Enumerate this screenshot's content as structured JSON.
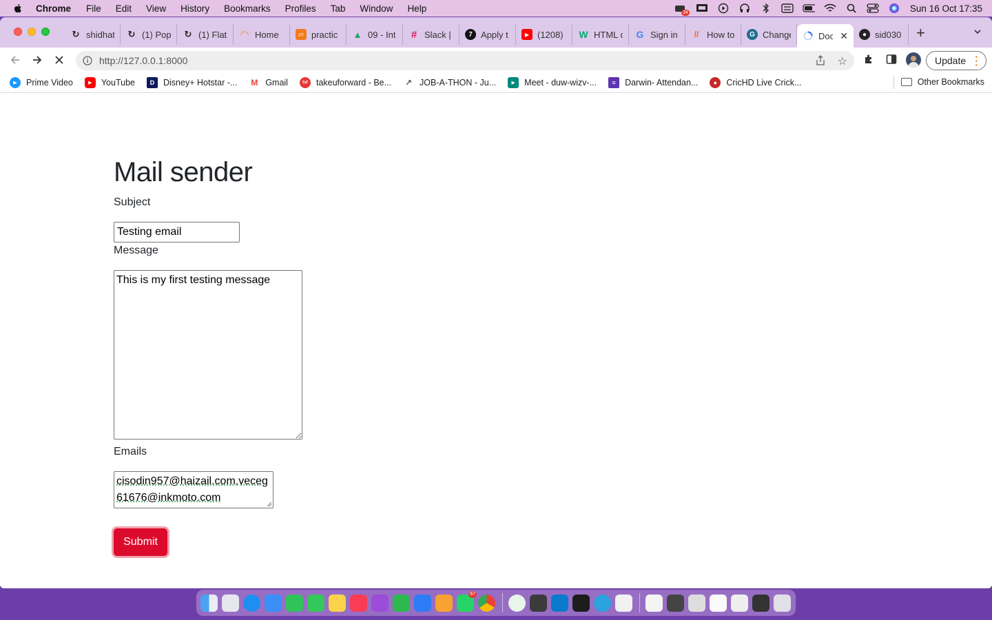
{
  "menubar": {
    "app_name": "Chrome",
    "items": [
      "File",
      "Edit",
      "View",
      "History",
      "Bookmarks",
      "Profiles",
      "Tab",
      "Window",
      "Help"
    ],
    "notification_badge": "34",
    "clock": "Sun 16 Oct  17:35"
  },
  "tabs": [
    {
      "label": "shidhat",
      "color": "#f3f3f3",
      "glyph": "↻"
    },
    {
      "label": "(1) Pop",
      "color": "#f3f3f3",
      "glyph": "↻"
    },
    {
      "label": "(1) Flat",
      "color": "#f3f3f3",
      "glyph": "↻"
    },
    {
      "label": "Home",
      "color": "#f68b1e",
      "glyph": "◠"
    },
    {
      "label": "practic",
      "color": "#f07c1c",
      "glyph": "▱"
    },
    {
      "label": "09 - Int",
      "color": "#1fa463",
      "glyph": "▲"
    },
    {
      "label": "Slack |",
      "color": "#4a154b",
      "glyph": "#"
    },
    {
      "label": "Apply t",
      "color": "#111111",
      "glyph": "7"
    },
    {
      "label": "(1208)",
      "color": "#ff0000",
      "glyph": "▶"
    },
    {
      "label": "HTML c",
      "color": "#04aa6d",
      "glyph": "W"
    },
    {
      "label": "Sign in",
      "color": "#ffffff",
      "glyph": "G"
    },
    {
      "label": "How to",
      "color": "#f26522",
      "glyph": "//"
    },
    {
      "label": "Change",
      "color": "#1e6e8c",
      "glyph": "G"
    }
  ],
  "active_tab": {
    "label": "Doc",
    "close": "✕"
  },
  "last_tab": {
    "label": "sid030"
  },
  "address_bar": {
    "url": "http://127.0.0.1:8000"
  },
  "update_button": {
    "label": "Update"
  },
  "bookmarks": [
    {
      "label": "Prime Video",
      "color": "#1a98ff",
      "glyph": "▶"
    },
    {
      "label": "YouTube",
      "color": "#ff0000",
      "glyph": "▶"
    },
    {
      "label": "Disney+ Hotstar -...",
      "color": "#0c1a5c",
      "glyph": "D"
    },
    {
      "label": "Gmail",
      "color": "#ea4335",
      "glyph": "M"
    },
    {
      "label": "takeuforward - Be...",
      "color": "#e53935",
      "glyph": "tuf"
    },
    {
      "label": "JOB-A-THON - Ju...",
      "color": "#7a8aa0",
      "glyph": "↗"
    },
    {
      "label": "Meet - duw-wizv-...",
      "color": "#00897b",
      "glyph": "▶"
    },
    {
      "label": "Darwin- Attendan...",
      "color": "#5e35b1",
      "glyph": "≡"
    },
    {
      "label": "CricHD Live Crick...",
      "color": "#c62828",
      "glyph": "●"
    }
  ],
  "other_bookmarks": "Other Bookmarks",
  "form": {
    "title": "Mail sender",
    "subject_label": "Subject",
    "subject_value": "Testing email",
    "message_label": "Message",
    "message_value": "This is my first testing message",
    "emails_label": "Emails",
    "emails_value": "cisodin957@haizail.com,veceg61676@inkmoto.com",
    "submit_label": "Submit"
  },
  "colors": {
    "submit": "#dc0b2b",
    "menubar": "#e4c3e6",
    "tabstrip": "#ddc9ea"
  },
  "dock_apps": [
    "finder-icon",
    "launchpad-icon",
    "safari-icon",
    "mail-icon",
    "facetime-icon",
    "messages-icon",
    "notes-icon",
    "music-icon",
    "podcasts-icon",
    "numbers-icon",
    "keynote-icon",
    "pages-icon",
    "whatsapp-icon",
    "chrome-icon",
    "mongodb-compass-icon",
    "anydesk-icon",
    "vscode-icon",
    "terminal-icon",
    "telegram-icon",
    "textedit-icon"
  ],
  "dock_badge": "67"
}
